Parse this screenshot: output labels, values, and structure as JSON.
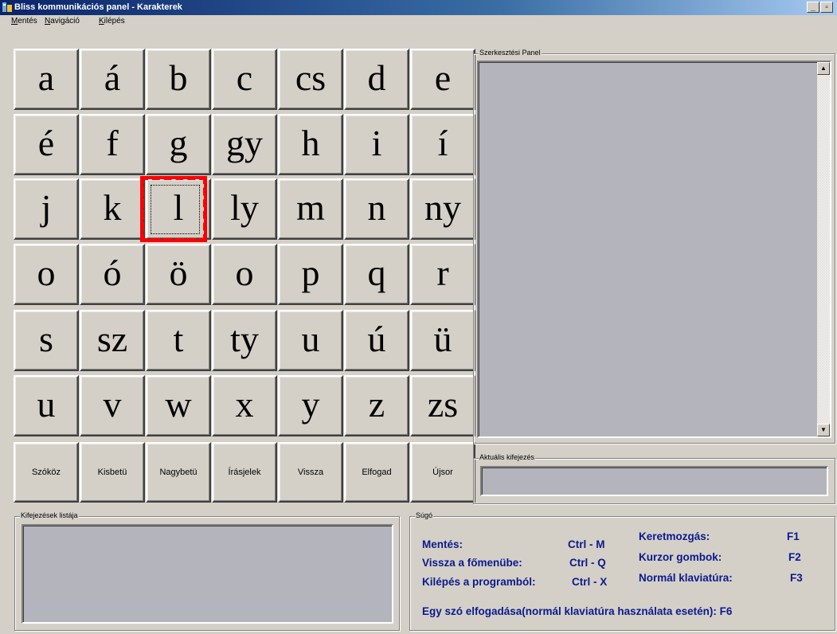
{
  "window": {
    "title": "Bliss kommunikációs panel - Karakterek"
  },
  "menu": [
    {
      "accel": "M",
      "rest": "entés"
    },
    {
      "accel": "N",
      "rest": "avigáció"
    },
    {
      "accel": "K",
      "rest": "ilépés"
    }
  ],
  "keys": [
    [
      "a",
      "á",
      "b",
      "c",
      "cs",
      "d",
      "e"
    ],
    [
      "é",
      "f",
      "g",
      "gy",
      "h",
      "i",
      "í"
    ],
    [
      "j",
      "k",
      "l",
      "ly",
      "m",
      "n",
      "ny"
    ],
    [
      "o",
      "ó",
      "ö",
      "o",
      "p",
      "q",
      "r"
    ],
    [
      "s",
      "sz",
      "t",
      "ty",
      "u",
      "ú",
      "ü"
    ],
    [
      "u",
      "v",
      "w",
      "x",
      "y",
      "z",
      "zs"
    ]
  ],
  "function_keys": [
    "Szóköz",
    "Kisbetü",
    "Nagybetü",
    "Írásjelek",
    "Vissza",
    "Elfogad",
    "Újsor"
  ],
  "selected_key": "l",
  "edit_panel": {
    "label": "Szerkesztési Panel"
  },
  "current_expression": {
    "label": "Aktuális kifejezés"
  },
  "expression_list": {
    "label": "Kifejezések listája"
  },
  "help": {
    "label": "Súgó",
    "rows": [
      {
        "action": "Mentés:",
        "shortcut": "Ctrl - M"
      },
      {
        "action": "Vissza a főmenübe:",
        "shortcut": "Ctrl - Q"
      },
      {
        "action": "Kilépés a programból:",
        "shortcut": "Ctrl - X"
      }
    ],
    "rows2": [
      {
        "action": "Keretmozgás:",
        "key": "F1"
      },
      {
        "action": "Kurzor gombok:",
        "key": "F2"
      },
      {
        "action": "Normál klaviatúra:",
        "key": "F3"
      }
    ],
    "footer": "Egy szó elfogadása(normál klaviatúra használata esetén):  F6"
  },
  "colors": {
    "focus_outer": "#ff0000",
    "focus_inner": "#ffff00",
    "help_text": "#0a1a8c",
    "field_bg": "#b4b4bc"
  }
}
